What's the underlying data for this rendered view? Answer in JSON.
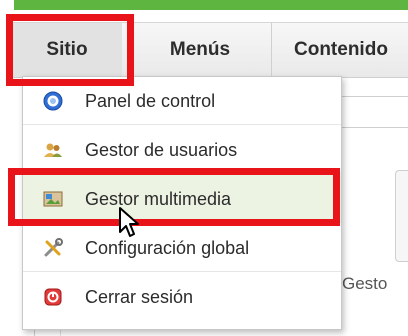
{
  "menubar": {
    "items": [
      {
        "label": "Sitio"
      },
      {
        "label": "Menús"
      },
      {
        "label": "Contenido"
      }
    ]
  },
  "dropdown": {
    "items": [
      {
        "label": "Panel de control",
        "icon": "control-panel-icon"
      },
      {
        "label": "Gestor de usuarios",
        "icon": "users-icon"
      },
      {
        "label": "Gestor multimedia",
        "icon": "media-icon",
        "active": true
      },
      {
        "label": "Configuración global",
        "icon": "tools-icon"
      },
      {
        "label": "Cerrar sesión",
        "icon": "logout-icon"
      }
    ]
  },
  "background": {
    "partial_text": "Gesto"
  },
  "colors": {
    "accent_green": "#5eb53f",
    "highlight_red": "#e8141a",
    "active_item_bg": "#edf3e3"
  }
}
